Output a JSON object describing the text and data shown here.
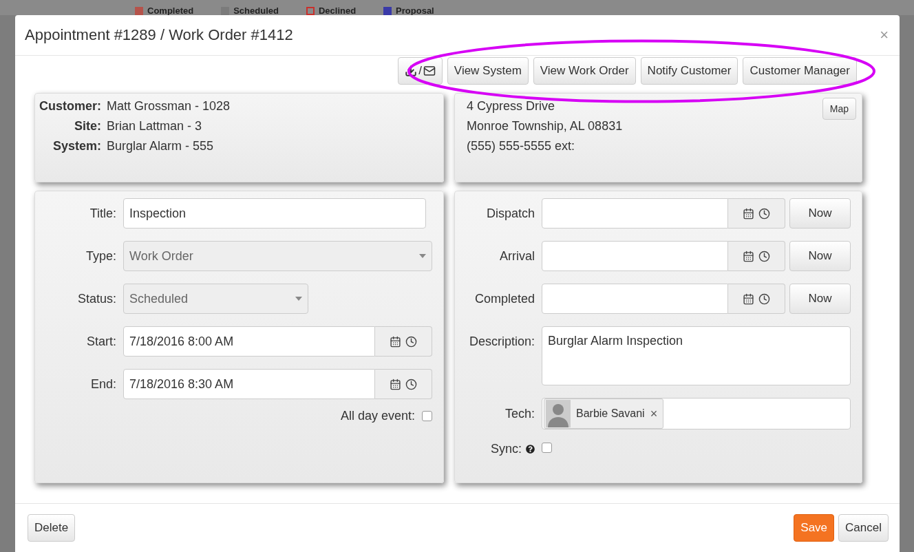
{
  "background": {
    "legend": [
      {
        "label": "Completed",
        "color": "#b5534b"
      },
      {
        "label": "Scheduled",
        "color": "#7b7b7b"
      },
      {
        "label": "Declined",
        "color": "#c9302c"
      },
      {
        "label": "Proposal",
        "color": "#3a3aa8"
      }
    ]
  },
  "dialog": {
    "title": "Appointment #1289 / Work Order #1412",
    "close": "×"
  },
  "toolbar": {
    "export_separator": "/",
    "buttons": [
      {
        "label": "View System"
      },
      {
        "label": "View Work Order"
      },
      {
        "label": "Notify Customer"
      },
      {
        "label": "Customer Manager"
      }
    ]
  },
  "annotation": {
    "kind": "ellipse",
    "color": "#d600f5"
  },
  "customer": {
    "fields": [
      {
        "label": "Customer:",
        "value": "Matt Grossman - 1028"
      },
      {
        "label": "Site:",
        "value": "Brian Lattman - 3"
      },
      {
        "label": "System:",
        "value": "Burglar Alarm - 555"
      }
    ]
  },
  "address": {
    "lines": [
      "4 Cypress Drive",
      "Monroe Township, AL 08831",
      "(555) 555-5555 ext:"
    ],
    "map_button": "Map"
  },
  "left_form": {
    "title": {
      "label": "Title:",
      "value": "Inspection"
    },
    "type": {
      "label": "Type:",
      "value": "Work Order",
      "disabled": true
    },
    "status": {
      "label": "Status:",
      "value": "Scheduled",
      "disabled": true
    },
    "start": {
      "label": "Start:",
      "value": "7/18/2016 8:00 AM"
    },
    "end": {
      "label": "End:",
      "value": "7/18/2016 8:30 AM"
    },
    "all_day": {
      "label": "All day event:",
      "checked": false
    }
  },
  "right_form": {
    "times": [
      {
        "label": "Dispatch",
        "now": "Now"
      },
      {
        "label": "Arrival",
        "now": "Now"
      },
      {
        "label": "Completed",
        "now": "Now"
      }
    ],
    "description": {
      "label": "Description:",
      "value": "Burglar Alarm Inspection"
    },
    "tech": {
      "label": "Tech:",
      "chips": [
        {
          "name": "Barbie Savani",
          "remove": "×"
        }
      ]
    },
    "sync": {
      "label": "Sync:",
      "checked": false
    }
  },
  "footer": {
    "delete": "Delete",
    "save": "Save",
    "cancel": "Cancel"
  }
}
